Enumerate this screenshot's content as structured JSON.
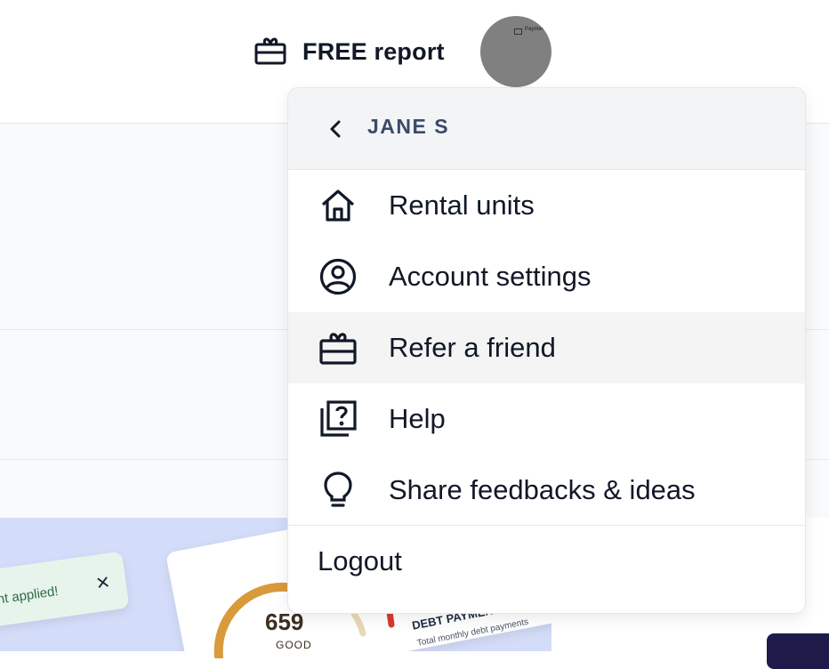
{
  "header": {
    "free_report_label": "FREE report",
    "avatar_text": "Payments"
  },
  "background": {
    "toast_text": "nt applied!",
    "toast_close": "✕",
    "score_value": "659",
    "score_label": "GOOD",
    "debt_title": "DEBT PAYMENTS",
    "debt_subtitle": "Total monthly debt payments"
  },
  "menu": {
    "user_name": "JANE S",
    "items": [
      {
        "label": "Rental units",
        "icon": "house-icon"
      },
      {
        "label": "Account settings",
        "icon": "user-circle-icon"
      },
      {
        "label": "Refer a friend",
        "icon": "gift-card-icon"
      },
      {
        "label": "Help",
        "icon": "help-question-icon"
      },
      {
        "label": "Share feedbacks & ideas",
        "icon": "lightbulb-icon"
      }
    ],
    "logout_label": "Logout"
  },
  "colors": {
    "highlight": "#f3f4f3",
    "header_bg": "#f3f4f6",
    "name_color": "#3b4a6b",
    "promo_bg": "#d3dcf8",
    "gauge_orange": "#d99a3c",
    "gauge_red": "#d83a2e"
  }
}
